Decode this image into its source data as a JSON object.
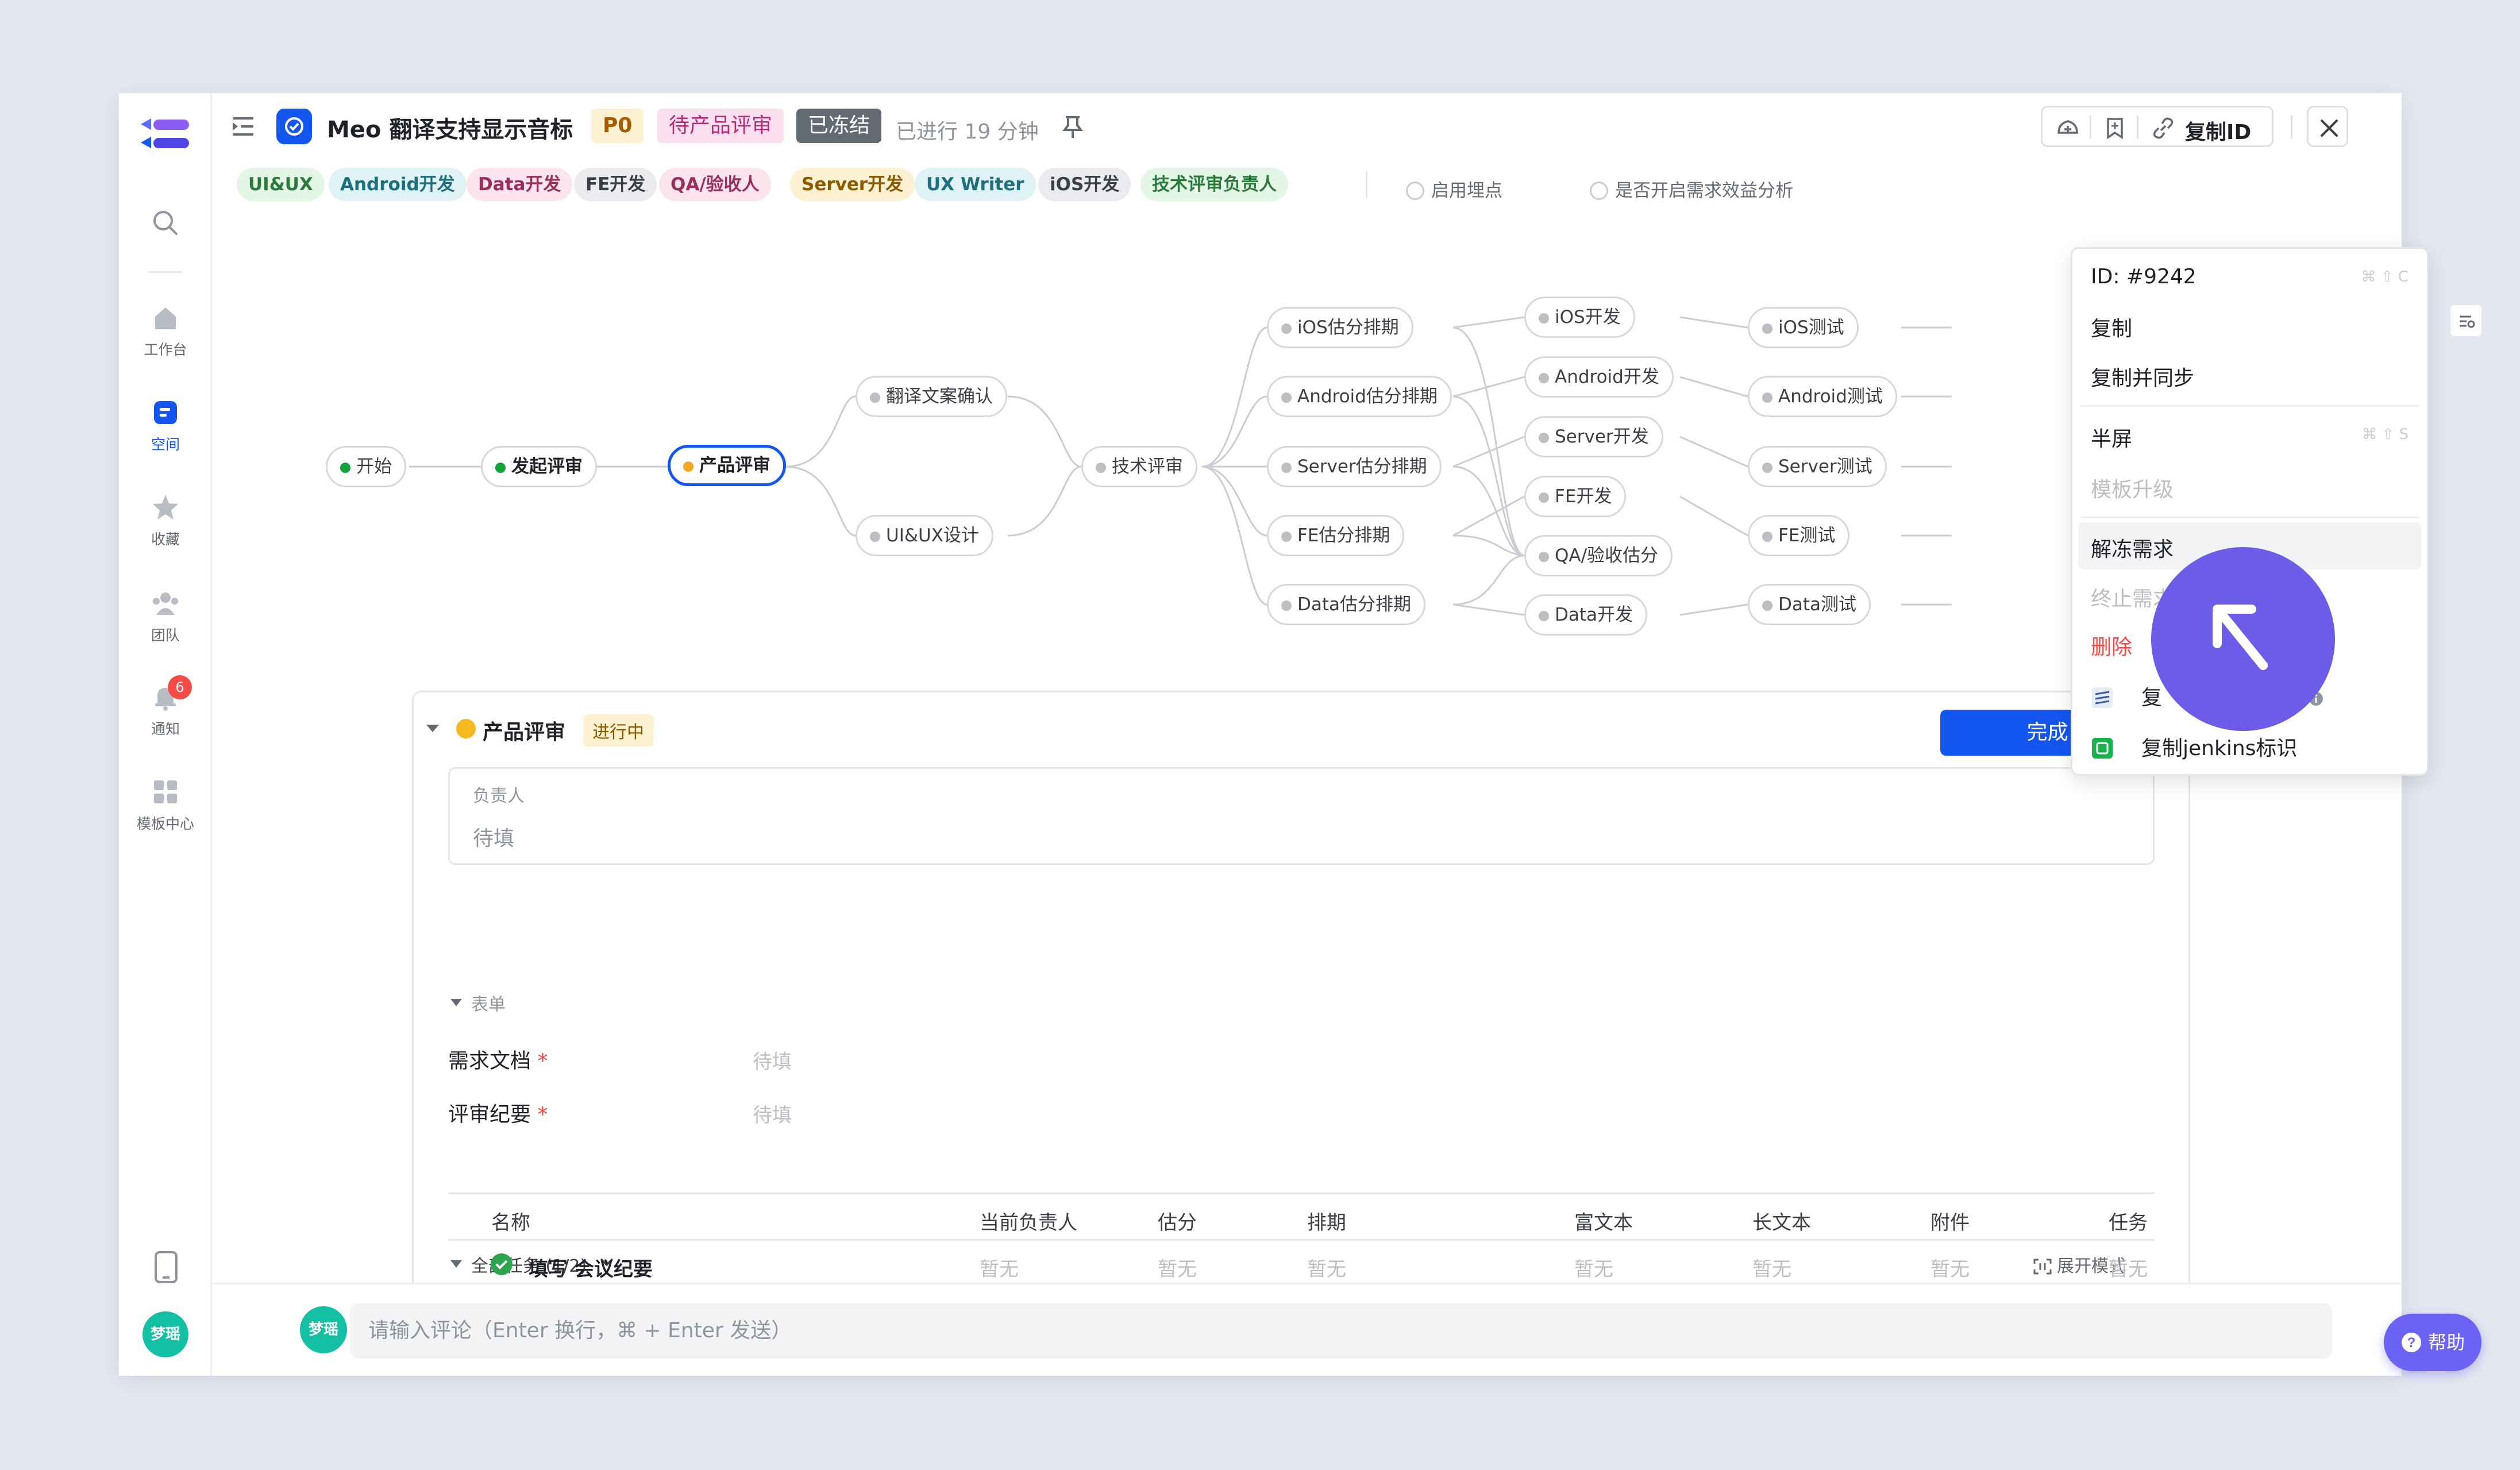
{
  "sidebar": {
    "items": [
      {
        "label": "工作台",
        "icon": "home-icon"
      },
      {
        "label": "空间",
        "icon": "space-icon",
        "active": true
      },
      {
        "label": "收藏",
        "icon": "star-icon"
      },
      {
        "label": "团队",
        "icon": "team-icon"
      },
      {
        "label": "通知",
        "icon": "bell-icon",
        "badge": "6"
      },
      {
        "label": "模板中心",
        "icon": "template-icon"
      }
    ],
    "user_avatar": "梦瑶"
  },
  "header": {
    "title": "Meo 翻译支持显示音标",
    "priority": "P0",
    "status": "待产品评审",
    "frozen": "已冻结",
    "elapsed": "已进行 19 分钟",
    "copy_id_label": "复制ID"
  },
  "role_tags": [
    {
      "label": "UI&UX",
      "bg": "#e4f7e6",
      "fg": "#2b7a3b"
    },
    {
      "label": "Android开发",
      "bg": "#dff3f7",
      "fg": "#1f6f7d"
    },
    {
      "label": "Data开发",
      "bg": "#fbe4ee",
      "fg": "#9a2f5d"
    },
    {
      "label": "FE开发",
      "bg": "#e9ebee",
      "fg": "#3b3f46"
    },
    {
      "label": "QA/验收人",
      "bg": "#fbe4ee",
      "fg": "#9a2f5d"
    },
    {
      "label": "Server开发",
      "bg": "#fdf1d2",
      "fg": "#8a5a00"
    },
    {
      "label": "UX Writer",
      "bg": "#dff3f7",
      "fg": "#1f6f7d"
    },
    {
      "label": "iOS开发",
      "bg": "#e9ebee",
      "fg": "#3b3f46"
    },
    {
      "label": "技术评审负责人",
      "bg": "#e4f7e6",
      "fg": "#2b7a3b"
    }
  ],
  "toggles": [
    "启用埋点",
    "是否开启需求效益分析"
  ],
  "workflow": {
    "nodes": {
      "start": "开始",
      "initiate": "发起评审",
      "product_review": "产品评审",
      "copy_confirm": "翻译文案确认",
      "uiux_design": "UI&UX设计",
      "tech_review": "技术评审",
      "ios_est": "iOS估分排期",
      "android_est": "Android估分排期",
      "server_est": "Server估分排期",
      "fe_est": "FE估分排期",
      "data_est": "Data估分排期",
      "ios_dev": "iOS开发",
      "android_dev": "Android开发",
      "server_dev": "Server开发",
      "fe_dev": "FE开发",
      "qa_est": "QA/验收估分",
      "data_dev": "Data开发",
      "ios_test": "iOS测试",
      "android_test": "Android测试",
      "server_test": "Server测试",
      "fe_test": "FE测试",
      "data_test": "Data测试"
    }
  },
  "panel": {
    "node_name": "产品评审",
    "node_status": "进行中",
    "complete_label": "完成",
    "owner_label": "负责人",
    "owner_value": "待填",
    "form_section": "表单",
    "fields": [
      {
        "label": "需求文档",
        "required": "*",
        "value": "待填"
      },
      {
        "label": "评审纪要",
        "required": "*",
        "value": "待填"
      }
    ],
    "tasks_title": "全部任务 (1/2)",
    "expand_mode": "展开模式",
    "task_columns": [
      "名称",
      "当前负责人",
      "估分",
      "排期",
      "富文本",
      "长文本",
      "附件",
      "任务"
    ],
    "task_rows": [
      {
        "name": "填写 会议纪要",
        "cells": [
          "暂无",
          "暂无",
          "暂无",
          "暂无",
          "暂无",
          "暂无",
          "暂无"
        ]
      }
    ]
  },
  "comment": {
    "placeholder": "请输入评论（Enter 换行，⌘ + Enter 发送）",
    "avatar": "梦瑶"
  },
  "help_label": "帮助",
  "menu": {
    "items": [
      {
        "label": "ID: #9242",
        "shortcut": "⌘ ⇧ C"
      },
      {
        "label": "复制"
      },
      {
        "label": "复制并同步"
      },
      {
        "label": "半屏",
        "shortcut": "⌘ ⇧ S"
      },
      {
        "label": "模板升级",
        "disabled": true
      },
      {
        "label": "解冻需求"
      },
      {
        "label": "终止需求",
        "disabled": true
      },
      {
        "label": "删除",
        "danger": true
      },
      {
        "label": "复制…ID",
        "visible_start": "复",
        "visible_end": "ID"
      },
      {
        "label": "复制jenkins标识"
      }
    ]
  },
  "colors": {
    "primary": "#1456f0",
    "cursor_bubble": "#6c5ce7",
    "danger": "#f54a45"
  }
}
